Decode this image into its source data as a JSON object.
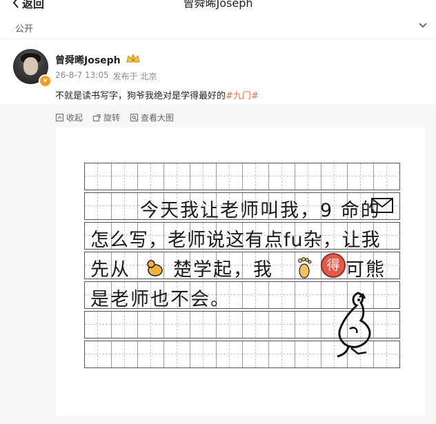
{
  "header": {
    "back_label": "返回",
    "title": "曾舜晞Joseph"
  },
  "filter": {
    "label": "公开"
  },
  "post": {
    "username": "曾舜晞Joseph",
    "time": "26-8-7 13:05",
    "source": "发布于 北京",
    "text": "不就是读书写字，狗爷我绝对是学得最好的",
    "topic": "#九门#",
    "verified_mark": "v"
  },
  "media_actions": {
    "collapse": "收起",
    "rotate": "旋转",
    "view_large": "查看大图"
  },
  "image": {
    "line1": "今天我让老师叫我，9 命的",
    "line2": "怎么写，老师说这有点fu杂，让我",
    "line3_a": "先从",
    "line3_b": "楚学起，我",
    "line3_c": "可熊",
    "line4": "是老师也不会。",
    "stamp_char": "得"
  },
  "colors": {
    "topic": "#eb7350",
    "badge": "#f29e1c",
    "media_bg": "#f7f7f7"
  }
}
